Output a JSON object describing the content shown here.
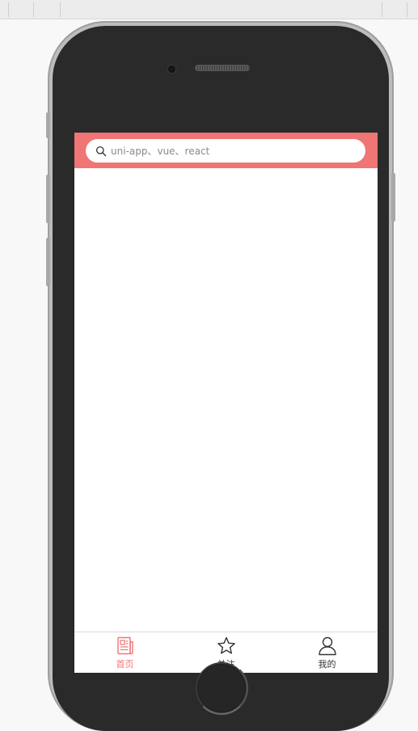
{
  "search": {
    "placeholder": "uni-app、vue、react"
  },
  "tabbar": {
    "items": [
      {
        "label": "首页",
        "icon": "news-icon",
        "active": true
      },
      {
        "label": "关注",
        "icon": "star-icon",
        "active": false
      },
      {
        "label": "我的",
        "icon": "user-icon",
        "active": false
      }
    ]
  },
  "colors": {
    "accent": "#f07575",
    "tab_inactive": "#333333",
    "phone_body": "#2a2a2a"
  }
}
